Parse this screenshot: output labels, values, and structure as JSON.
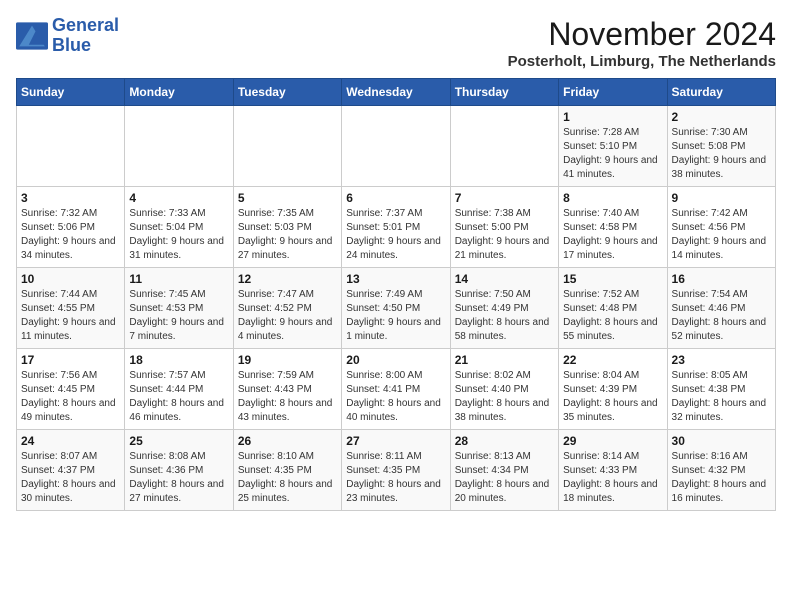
{
  "logo": {
    "text_general": "General",
    "text_blue": "Blue"
  },
  "header": {
    "month_title": "November 2024",
    "subtitle": "Posterholt, Limburg, The Netherlands"
  },
  "days_of_week": [
    "Sunday",
    "Monday",
    "Tuesday",
    "Wednesday",
    "Thursday",
    "Friday",
    "Saturday"
  ],
  "weeks": [
    [
      {
        "day": "",
        "info": ""
      },
      {
        "day": "",
        "info": ""
      },
      {
        "day": "",
        "info": ""
      },
      {
        "day": "",
        "info": ""
      },
      {
        "day": "",
        "info": ""
      },
      {
        "day": "1",
        "info": "Sunrise: 7:28 AM\nSunset: 5:10 PM\nDaylight: 9 hours and 41 minutes."
      },
      {
        "day": "2",
        "info": "Sunrise: 7:30 AM\nSunset: 5:08 PM\nDaylight: 9 hours and 38 minutes."
      }
    ],
    [
      {
        "day": "3",
        "info": "Sunrise: 7:32 AM\nSunset: 5:06 PM\nDaylight: 9 hours and 34 minutes."
      },
      {
        "day": "4",
        "info": "Sunrise: 7:33 AM\nSunset: 5:04 PM\nDaylight: 9 hours and 31 minutes."
      },
      {
        "day": "5",
        "info": "Sunrise: 7:35 AM\nSunset: 5:03 PM\nDaylight: 9 hours and 27 minutes."
      },
      {
        "day": "6",
        "info": "Sunrise: 7:37 AM\nSunset: 5:01 PM\nDaylight: 9 hours and 24 minutes."
      },
      {
        "day": "7",
        "info": "Sunrise: 7:38 AM\nSunset: 5:00 PM\nDaylight: 9 hours and 21 minutes."
      },
      {
        "day": "8",
        "info": "Sunrise: 7:40 AM\nSunset: 4:58 PM\nDaylight: 9 hours and 17 minutes."
      },
      {
        "day": "9",
        "info": "Sunrise: 7:42 AM\nSunset: 4:56 PM\nDaylight: 9 hours and 14 minutes."
      }
    ],
    [
      {
        "day": "10",
        "info": "Sunrise: 7:44 AM\nSunset: 4:55 PM\nDaylight: 9 hours and 11 minutes."
      },
      {
        "day": "11",
        "info": "Sunrise: 7:45 AM\nSunset: 4:53 PM\nDaylight: 9 hours and 7 minutes."
      },
      {
        "day": "12",
        "info": "Sunrise: 7:47 AM\nSunset: 4:52 PM\nDaylight: 9 hours and 4 minutes."
      },
      {
        "day": "13",
        "info": "Sunrise: 7:49 AM\nSunset: 4:50 PM\nDaylight: 9 hours and 1 minute."
      },
      {
        "day": "14",
        "info": "Sunrise: 7:50 AM\nSunset: 4:49 PM\nDaylight: 8 hours and 58 minutes."
      },
      {
        "day": "15",
        "info": "Sunrise: 7:52 AM\nSunset: 4:48 PM\nDaylight: 8 hours and 55 minutes."
      },
      {
        "day": "16",
        "info": "Sunrise: 7:54 AM\nSunset: 4:46 PM\nDaylight: 8 hours and 52 minutes."
      }
    ],
    [
      {
        "day": "17",
        "info": "Sunrise: 7:56 AM\nSunset: 4:45 PM\nDaylight: 8 hours and 49 minutes."
      },
      {
        "day": "18",
        "info": "Sunrise: 7:57 AM\nSunset: 4:44 PM\nDaylight: 8 hours and 46 minutes."
      },
      {
        "day": "19",
        "info": "Sunrise: 7:59 AM\nSunset: 4:43 PM\nDaylight: 8 hours and 43 minutes."
      },
      {
        "day": "20",
        "info": "Sunrise: 8:00 AM\nSunset: 4:41 PM\nDaylight: 8 hours and 40 minutes."
      },
      {
        "day": "21",
        "info": "Sunrise: 8:02 AM\nSunset: 4:40 PM\nDaylight: 8 hours and 38 minutes."
      },
      {
        "day": "22",
        "info": "Sunrise: 8:04 AM\nSunset: 4:39 PM\nDaylight: 8 hours and 35 minutes."
      },
      {
        "day": "23",
        "info": "Sunrise: 8:05 AM\nSunset: 4:38 PM\nDaylight: 8 hours and 32 minutes."
      }
    ],
    [
      {
        "day": "24",
        "info": "Sunrise: 8:07 AM\nSunset: 4:37 PM\nDaylight: 8 hours and 30 minutes."
      },
      {
        "day": "25",
        "info": "Sunrise: 8:08 AM\nSunset: 4:36 PM\nDaylight: 8 hours and 27 minutes."
      },
      {
        "day": "26",
        "info": "Sunrise: 8:10 AM\nSunset: 4:35 PM\nDaylight: 8 hours and 25 minutes."
      },
      {
        "day": "27",
        "info": "Sunrise: 8:11 AM\nSunset: 4:35 PM\nDaylight: 8 hours and 23 minutes."
      },
      {
        "day": "28",
        "info": "Sunrise: 8:13 AM\nSunset: 4:34 PM\nDaylight: 8 hours and 20 minutes."
      },
      {
        "day": "29",
        "info": "Sunrise: 8:14 AM\nSunset: 4:33 PM\nDaylight: 8 hours and 18 minutes."
      },
      {
        "day": "30",
        "info": "Sunrise: 8:16 AM\nSunset: 4:32 PM\nDaylight: 8 hours and 16 minutes."
      }
    ]
  ]
}
